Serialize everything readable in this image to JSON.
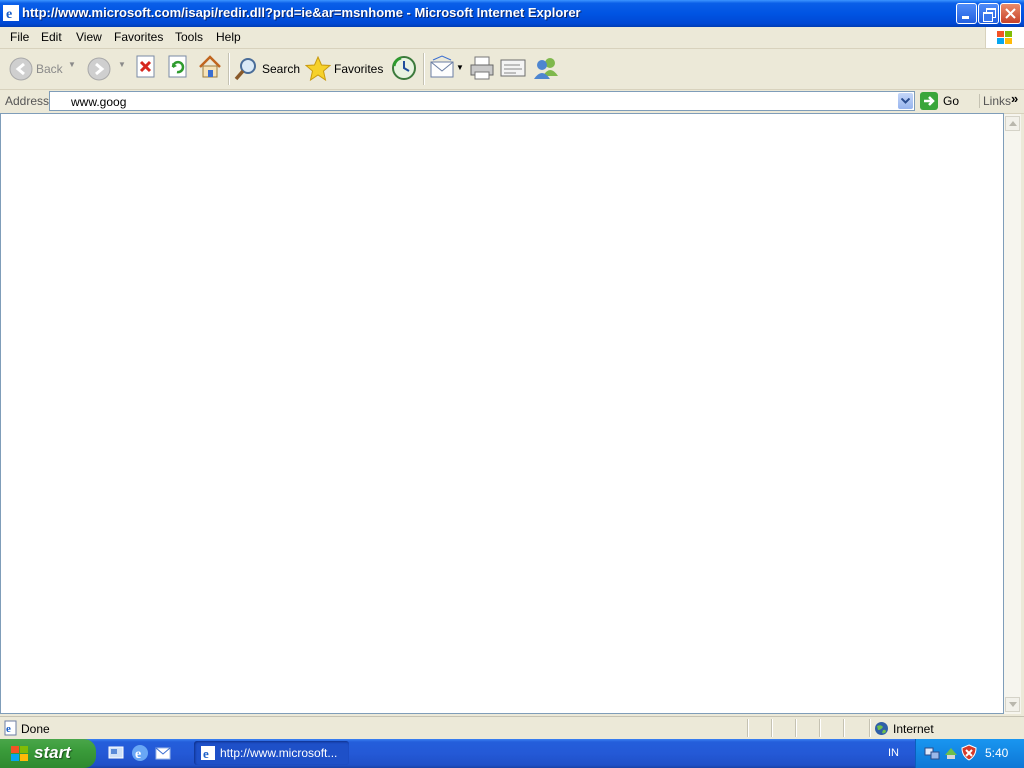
{
  "window": {
    "title": "http://www.microsoft.com/isapi/redir.dll?prd=ie&ar=msnhome - Microsoft Internet Explorer"
  },
  "menu": [
    "File",
    "Edit",
    "View",
    "Favorites",
    "Tools",
    "Help"
  ],
  "toolbar": {
    "back_label": "Back",
    "search_label": "Search",
    "favorites_label": "Favorites"
  },
  "address": {
    "label": "Address",
    "value": "www.goog",
    "go_label": "Go",
    "links_label": "Links"
  },
  "status": {
    "text": "Done",
    "zone": "Internet"
  },
  "taskbar": {
    "start_label": "start",
    "task_label": "http://www.microsoft...",
    "language": "IN",
    "clock": "5:40"
  },
  "colors": {
    "titlebar": "#0054e3",
    "taskbar": "#245edb",
    "start_button": "#3a9b3a",
    "chrome": "#ece9d8"
  }
}
